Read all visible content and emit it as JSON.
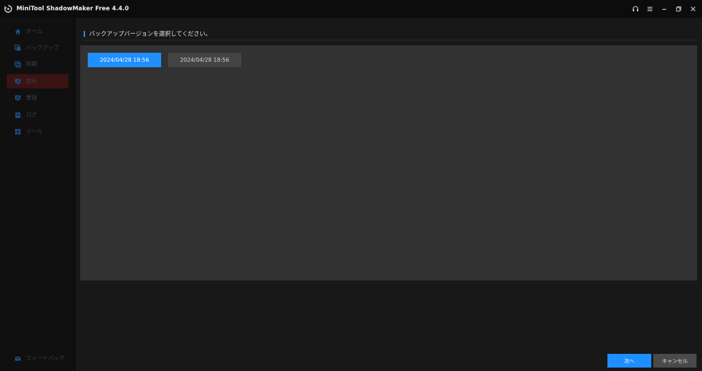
{
  "window": {
    "title": "MiniTool ShadowMaker Free 4.4.0",
    "controls": [
      "headset-icon",
      "menu-icon",
      "minimize-icon",
      "restore-icon",
      "close-icon"
    ]
  },
  "sidebar": {
    "items": [
      {
        "label": "ホーム",
        "icon": "home-icon"
      },
      {
        "label": "バックアップ",
        "icon": "backup-icon"
      },
      {
        "label": "同期",
        "icon": "sync-icon"
      },
      {
        "label": "復元",
        "icon": "restore-icon",
        "active": true
      },
      {
        "label": "管理",
        "icon": "manage-icon"
      },
      {
        "label": "ログ",
        "icon": "log-icon"
      },
      {
        "label": "ツール",
        "icon": "tools-icon"
      }
    ],
    "feedback_label": "フィードバック"
  },
  "main": {
    "header": "バックアップバージョンを選択してください。",
    "versions": [
      {
        "label": "2024/04/28 18:56",
        "selected": true
      },
      {
        "label": "2024/04/28 18:56",
        "selected": false
      }
    ],
    "next_label": "次へ",
    "cancel_label": "キャンセル"
  },
  "colors": {
    "accent": "#1f8fff",
    "titlebar": "#0c0c0c",
    "sidebar": "#101010",
    "active_nav": "#3a1313",
    "panel": "#323232"
  }
}
